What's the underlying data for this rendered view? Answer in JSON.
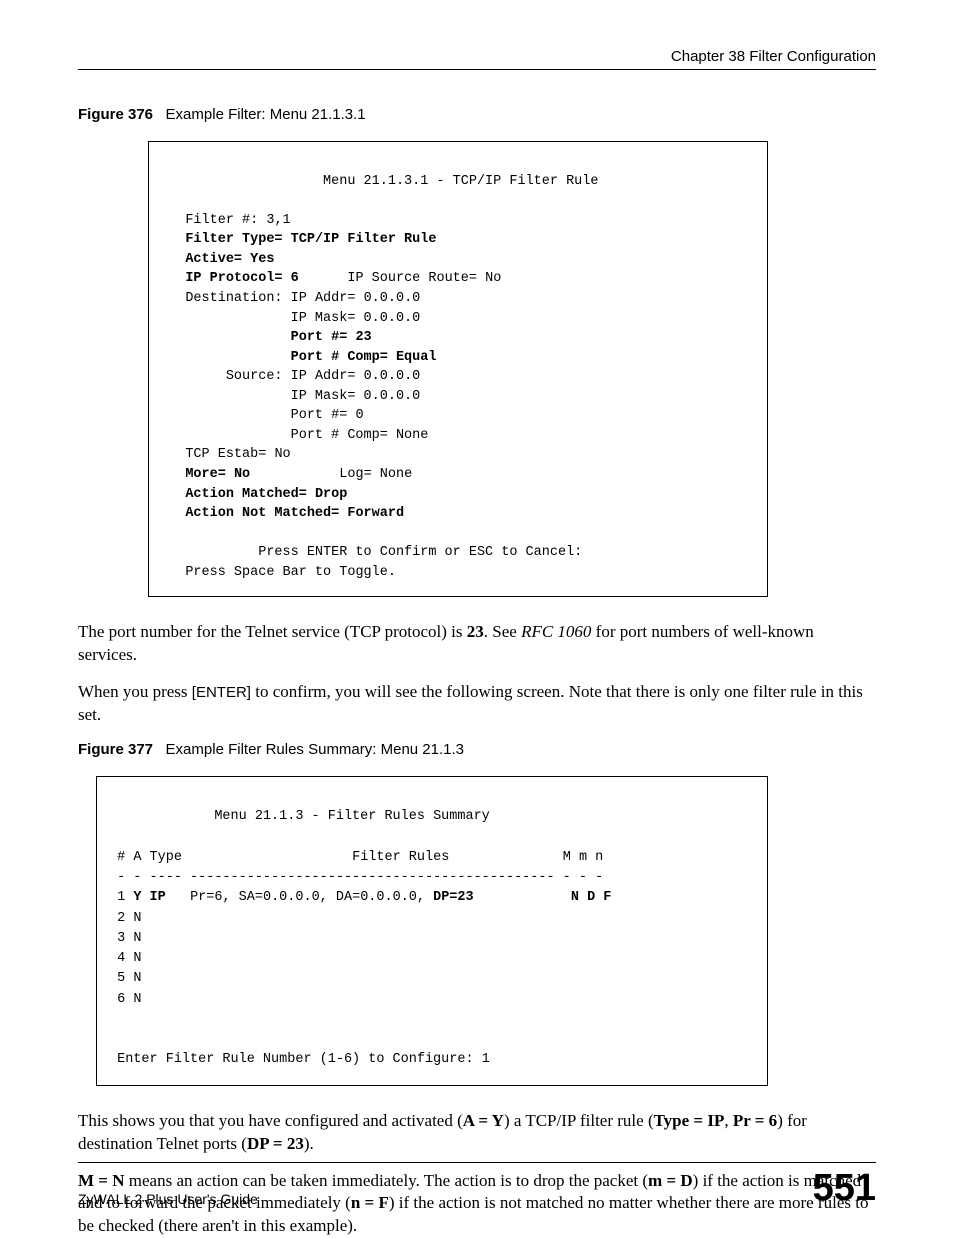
{
  "header": {
    "chapter": "Chapter 38 Filter Configuration"
  },
  "fig376": {
    "label": "Figure 376",
    "caption": "Example Filter: Menu 21.1.3.1",
    "menu_title": "Menu 21.1.3.1 - TCP/IP Filter Rule",
    "filter_no_label": "Filter #:",
    "filter_no": "3,1",
    "filter_type_label": "Filter Type=",
    "filter_type": "TCP/IP Filter Rule",
    "active_label": "Active=",
    "active": "Yes",
    "ip_proto_label": "IP Protocol=",
    "ip_proto": "6",
    "ip_src_route_label": "IP Source Route=",
    "ip_src_route": "No",
    "dest_label": "Destination:",
    "src_label": "Source:",
    "ip_addr_label": "IP Addr=",
    "dest_ip_addr": "0.0.0.0",
    "ip_mask_label": "IP Mask=",
    "dest_ip_mask": "0.0.0.0",
    "port_label": "Port #=",
    "dest_port": "23",
    "port_comp_label": "Port # Comp=",
    "dest_port_comp": "Equal",
    "src_ip_addr": "0.0.0.0",
    "src_ip_mask": "0.0.0.0",
    "src_port": "0",
    "src_port_comp": "None",
    "tcp_estab_label": "TCP Estab=",
    "tcp_estab": "No",
    "more_label": "More=",
    "more": "No",
    "log_label": "Log=",
    "log": "None",
    "action_matched_label": "Action Matched=",
    "action_matched": "Drop",
    "action_not_matched_label": "Action Not Matched=",
    "action_not_matched": "Forward",
    "press_enter": "Press ENTER to Confirm or ESC to Cancel:",
    "press_space": "Press Space Bar to Toggle."
  },
  "para1_a": "The port number for the Telnet service (TCP protocol) is ",
  "para1_b": "23",
  "para1_c": ". See ",
  "para1_d": "RFC 1060",
  "para1_e": " for port numbers of well-known services.",
  "para2_a": "When you press ",
  "para2_key": "[ENTER]",
  "para2_b": " to confirm, you will see the following screen. Note that there is only one filter rule in this set.",
  "fig377": {
    "label": "Figure 377",
    "caption": "Example Filter Rules Summary: Menu 21.1.3",
    "menu_title": "Menu 21.1.3 - Filter Rules Summary",
    "hdr_hash": "#",
    "hdr_a": "A",
    "hdr_type": "Type",
    "hdr_rules": "Filter Rules",
    "hdr_M": "M",
    "hdr_m": "m",
    "hdr_n": "n",
    "sep": "- - ---- --------------------------------------------- - - -",
    "rows": [
      {
        "n": "1",
        "a": "Y",
        "type": "IP",
        "rule_a": "Pr=6, SA=0.0.0.0, DA=0.0.0.0, ",
        "rule_b": "DP=23",
        "M": "N",
        "m": "D",
        "nn": "F"
      },
      {
        "n": "2",
        "a": "N"
      },
      {
        "n": "3",
        "a": "N"
      },
      {
        "n": "4",
        "a": "N"
      },
      {
        "n": "5",
        "a": "N"
      },
      {
        "n": "6",
        "a": "N"
      }
    ],
    "prompt": "Enter Filter Rule Number (1-6) to Configure: 1"
  },
  "para3_a": "This shows you that you have configured and activated (",
  "para3_b": "A = Y",
  "para3_c": ") a TCP/IP filter rule (",
  "para3_d": "Type = IP",
  "para3_e": ", ",
  "para3_f": "Pr = 6",
  "para3_g": ") for destination Telnet ports (",
  "para3_h": "DP = 23",
  "para3_i": ").",
  "para4_a": "M = N",
  "para4_b": " means an action can be taken immediately. The action is to drop the packet (",
  "para4_c": "m = D",
  "para4_d": ") if the action is matched and to forward the packet immediately (",
  "para4_e": "n = F",
  "para4_f": ") if the action is not matched no matter whether there are more rules to be checked (there aren't in this example).",
  "footer": {
    "guide": "ZyWALL 2 Plus User's Guide",
    "page": "551"
  }
}
